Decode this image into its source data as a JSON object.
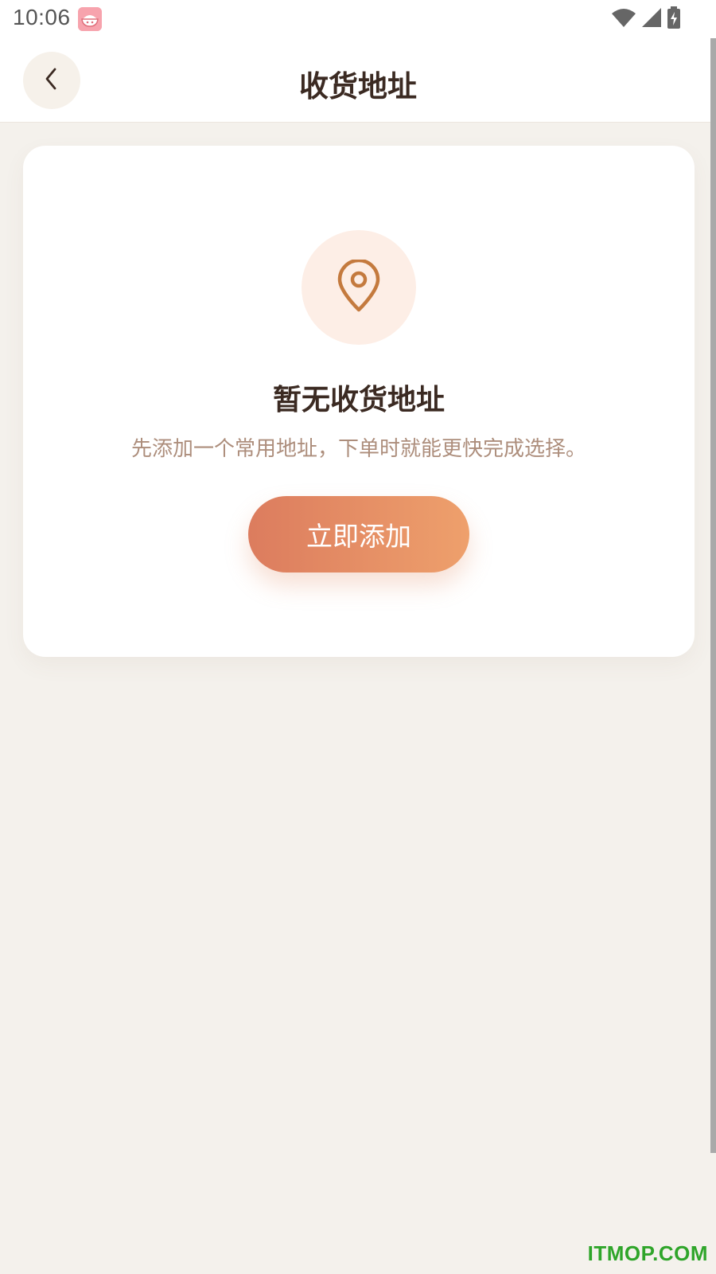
{
  "status_bar": {
    "time": "10:06",
    "app_icon": "rice-bowl-icon",
    "wifi_icon": "wifi-icon",
    "signal_icon": "cell-signal-icon",
    "battery_icon": "battery-charging-icon"
  },
  "header": {
    "back_icon": "chevron-left-icon",
    "title": "收货地址"
  },
  "empty_state": {
    "icon": "location-pin-icon",
    "title": "暂无收货地址",
    "description": "先添加一个常用地址，下单时就能更快完成选择。",
    "button_label": "立即添加"
  },
  "colors": {
    "background": "#f4f1ec",
    "accent_start": "#dc7c5e",
    "accent_end": "#eea06c",
    "pin": "#c47a3e",
    "title_text": "#3b2a22",
    "subtitle_text": "#ad8e7c"
  },
  "watermark": "ITMOP.COM"
}
